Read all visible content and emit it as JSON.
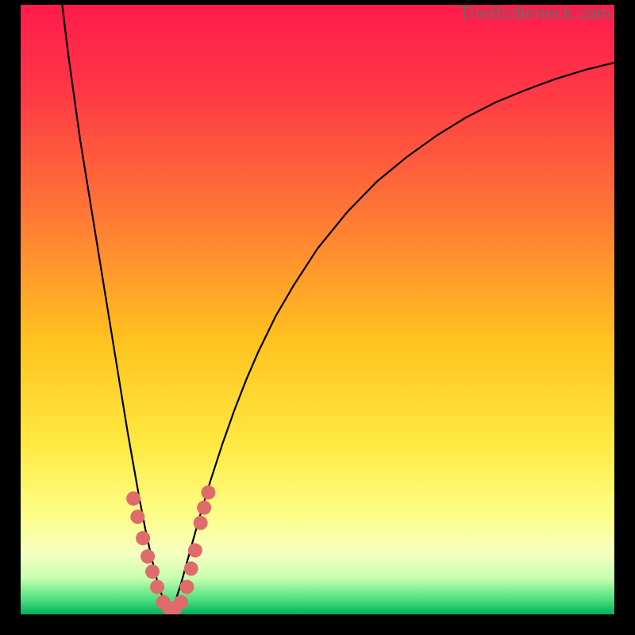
{
  "watermark": "TheBottleneck.com",
  "chart_data": {
    "type": "line",
    "title": "",
    "xlabel": "",
    "ylabel": "",
    "xlim": [
      0,
      100
    ],
    "ylim": [
      0,
      100
    ],
    "grid": false,
    "background_gradient": {
      "stops": [
        {
          "offset": 0.0,
          "color": "#ff1a4d"
        },
        {
          "offset": 0.15,
          "color": "#ff3a45"
        },
        {
          "offset": 0.35,
          "color": "#ff7a35"
        },
        {
          "offset": 0.55,
          "color": "#ffc21f"
        },
        {
          "offset": 0.72,
          "color": "#ffe940"
        },
        {
          "offset": 0.84,
          "color": "#fdff8a"
        },
        {
          "offset": 0.9,
          "color": "#f4ffc0"
        },
        {
          "offset": 0.94,
          "color": "#c8ffb0"
        },
        {
          "offset": 0.975,
          "color": "#50e080"
        },
        {
          "offset": 1.0,
          "color": "#00b060"
        }
      ]
    },
    "series": [
      {
        "name": "left-branch",
        "x": [
          7,
          8,
          9,
          10,
          11,
          12,
          13,
          14,
          15,
          16,
          17,
          18,
          19,
          20,
          21,
          22,
          23,
          24,
          25
        ],
        "y": [
          100,
          92,
          85,
          78,
          72,
          66,
          60,
          54,
          48,
          42,
          36,
          30,
          24.5,
          19,
          14,
          9.5,
          5.5,
          2.5,
          0.5
        ]
      },
      {
        "name": "right-branch",
        "x": [
          25,
          26,
          27,
          28,
          29,
          30,
          32,
          34,
          36,
          38,
          40,
          43,
          46,
          50,
          55,
          60,
          65,
          70,
          75,
          80,
          85,
          90,
          95,
          100
        ],
        "y": [
          0.5,
          2,
          5,
          8.5,
          12,
          15.5,
          22,
          28,
          33.5,
          38.5,
          43,
          49,
          54,
          60,
          66,
          71,
          75,
          78.5,
          81.5,
          84,
          86,
          87.8,
          89.3,
          90.5
        ]
      }
    ],
    "markers": {
      "name": "highlight-dots",
      "color": "#e06b6b",
      "radius": 9,
      "points": [
        {
          "x": 19.0,
          "y": 19.0
        },
        {
          "x": 19.7,
          "y": 16.0
        },
        {
          "x": 20.6,
          "y": 12.5
        },
        {
          "x": 21.4,
          "y": 9.5
        },
        {
          "x": 22.2,
          "y": 7.0
        },
        {
          "x": 23.0,
          "y": 4.5
        },
        {
          "x": 24.0,
          "y": 2.0
        },
        {
          "x": 25.0,
          "y": 1.0
        },
        {
          "x": 26.0,
          "y": 1.0
        },
        {
          "x": 27.0,
          "y": 2.0
        },
        {
          "x": 28.0,
          "y": 4.5
        },
        {
          "x": 28.7,
          "y": 7.5
        },
        {
          "x": 29.4,
          "y": 10.5
        },
        {
          "x": 30.3,
          "y": 15.0
        },
        {
          "x": 30.9,
          "y": 17.5
        },
        {
          "x": 31.6,
          "y": 20.0
        }
      ]
    }
  }
}
